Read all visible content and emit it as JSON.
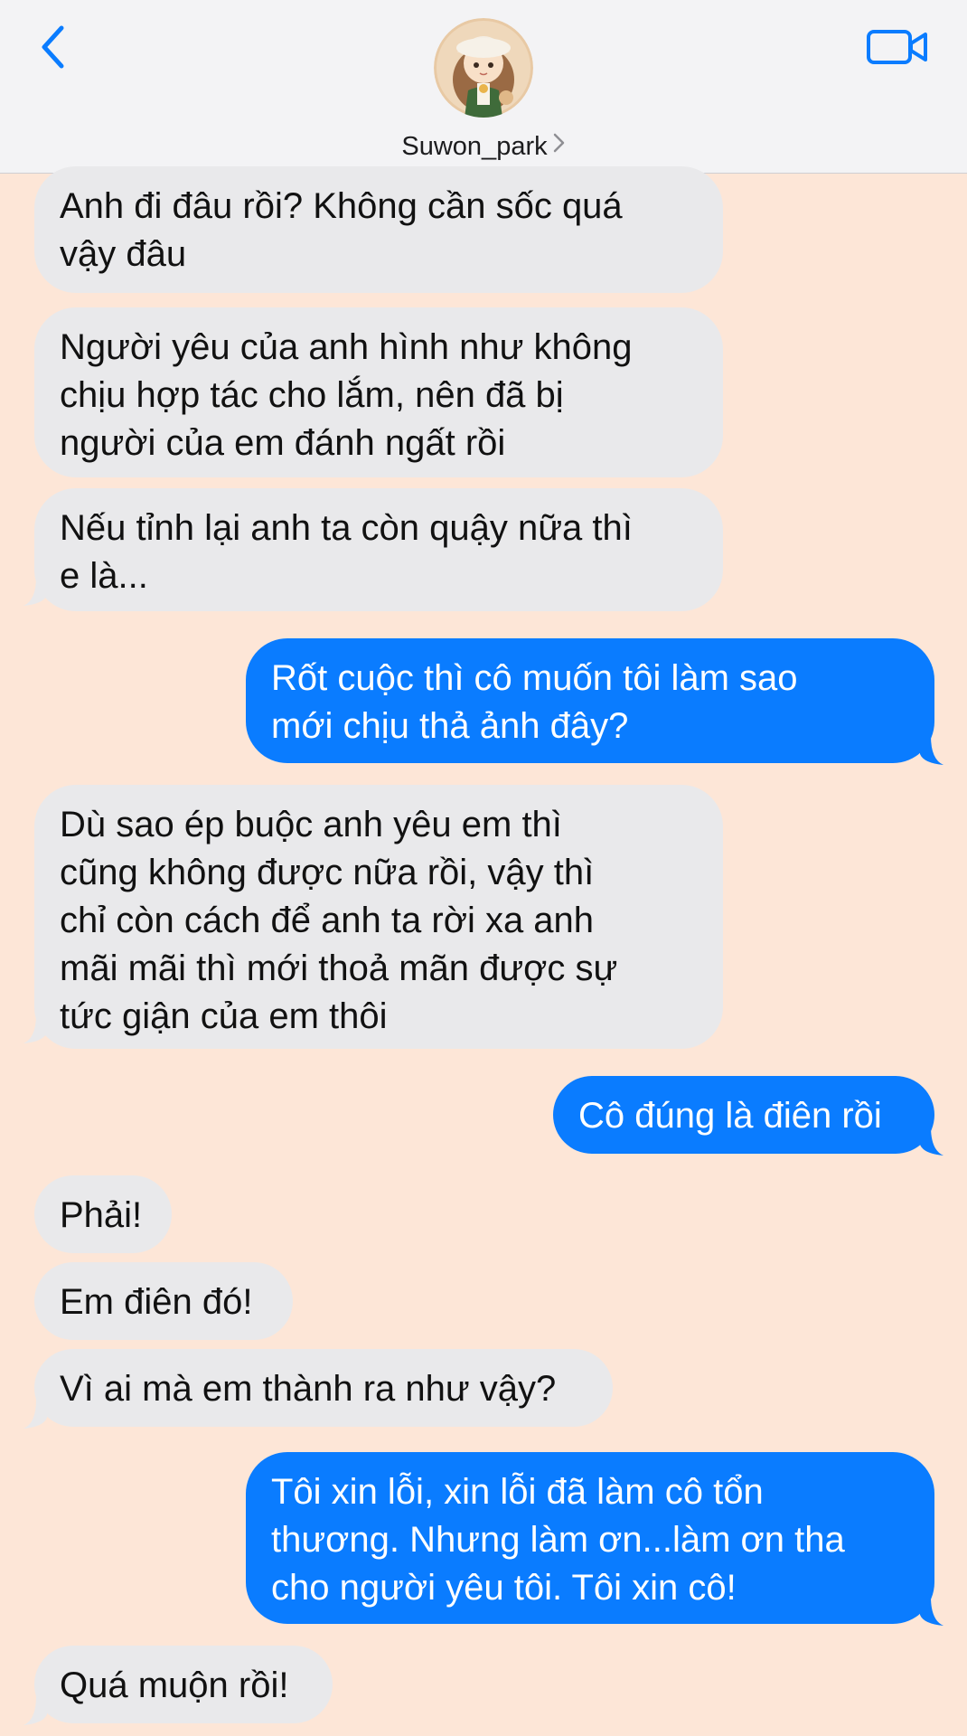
{
  "header": {
    "contact_name": "Suwon_park",
    "icons": {
      "back": "chevron-left-icon",
      "video": "video-camera-icon",
      "disclosure": "chevron-right-icon"
    }
  },
  "colors": {
    "background": "#fde6d7",
    "incoming_bubble": "#e9e9eb",
    "outgoing_bubble": "#0a7cff",
    "accent": "#0a7cff"
  },
  "messages": [
    {
      "from": "them",
      "text": "Anh đi đâu rồi? Không cần sốc quá\nvậy đâu"
    },
    {
      "from": "them",
      "text": "Người yêu của anh hình như không\nchịu hợp tác cho lắm, nên đã bị\nngười của em đánh ngất rồi"
    },
    {
      "from": "them",
      "text": "Nếu tỉnh lại anh ta còn quậy nữa thì\ne là..."
    },
    {
      "from": "me",
      "text": "Rốt cuộc thì cô muốn tôi làm sao\nmới chịu thả ảnh đây?"
    },
    {
      "from": "them",
      "text": "Dù sao ép buộc anh yêu em thì\ncũng không được nữa rồi, vậy thì\nchỉ còn cách để anh ta rời xa anh\nmãi mãi thì mới thoả mãn được sự\ntức giận của em thôi"
    },
    {
      "from": "me",
      "text": "Cô đúng là điên rồi"
    },
    {
      "from": "them",
      "text": "Phải!"
    },
    {
      "from": "them",
      "text": "Em điên đó!"
    },
    {
      "from": "them",
      "text": "Vì ai mà em thành ra như vậy?"
    },
    {
      "from": "me",
      "text": "Tôi xin lỗi, xin lỗi đã làm cô tổn\nthương. Nhưng làm ơn...làm ơn tha\ncho người yêu tôi. Tôi xin cô!"
    },
    {
      "from": "them",
      "text": "Quá muộn rồi!"
    }
  ]
}
